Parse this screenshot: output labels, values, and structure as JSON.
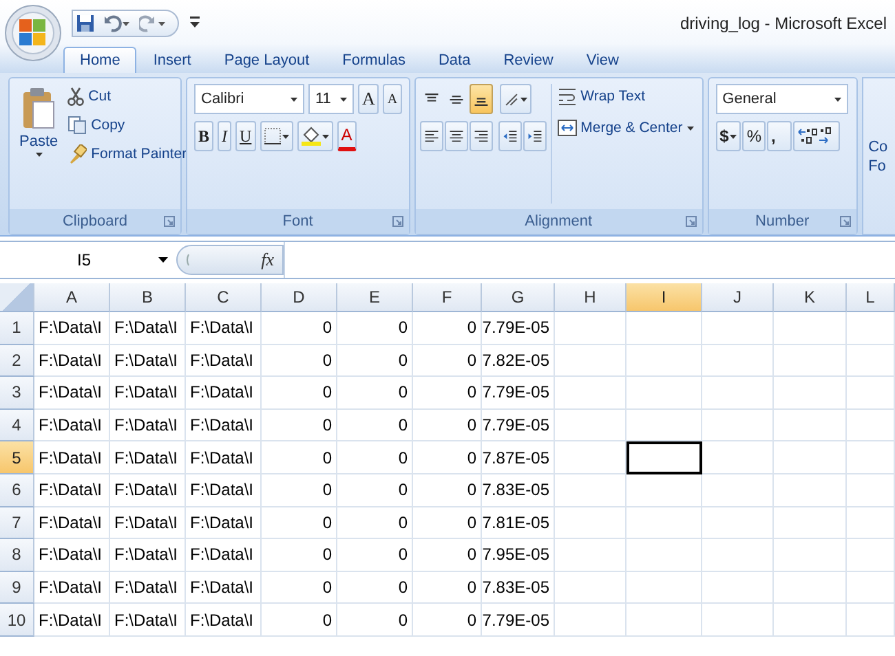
{
  "window": {
    "title": "driving_log - Microsoft Excel"
  },
  "tabs": [
    {
      "label": "Home",
      "selected": true
    },
    {
      "label": "Insert",
      "selected": false
    },
    {
      "label": "Page Layout",
      "selected": false
    },
    {
      "label": "Formulas",
      "selected": false
    },
    {
      "label": "Data",
      "selected": false
    },
    {
      "label": "Review",
      "selected": false
    },
    {
      "label": "View",
      "selected": false
    }
  ],
  "ribbon": {
    "clipboard": {
      "name": "Clipboard",
      "paste": "Paste",
      "cut": "Cut",
      "copy": "Copy",
      "format_painter": "Format Painter"
    },
    "font": {
      "name": "Font",
      "font_name": "Calibri",
      "font_size": "11",
      "grow": "A",
      "shrink": "A",
      "bold": "B",
      "italic": "I",
      "underline": "U",
      "font_color": "A"
    },
    "alignment": {
      "name": "Alignment",
      "vertical": [
        {
          "selected": false
        },
        {
          "selected": false
        },
        {
          "selected": true
        }
      ],
      "wrap_text": "Wrap Text",
      "merge": "Merge & Center"
    },
    "number": {
      "name": "Number",
      "format": "General",
      "currency": "$",
      "percent": "%",
      "comma": ","
    },
    "styles": {
      "line_1": "Co",
      "line_2": "Fo"
    }
  },
  "formula_bar": {
    "name_box": "I5",
    "function_label": "fx"
  },
  "sheet": {
    "columns": [
      {
        "label": "A",
        "selected": false
      },
      {
        "label": "B",
        "selected": false
      },
      {
        "label": "C",
        "selected": false
      },
      {
        "label": "D",
        "selected": false
      },
      {
        "label": "E",
        "selected": false
      },
      {
        "label": "F",
        "selected": false
      },
      {
        "label": "G",
        "selected": false
      },
      {
        "label": "H",
        "selected": false
      },
      {
        "label": "I",
        "selected": true
      },
      {
        "label": "J",
        "selected": false
      },
      {
        "label": "K",
        "selected": false
      },
      {
        "label": "L",
        "selected": false
      }
    ],
    "rows": [
      {
        "number": "1",
        "selected": false,
        "cells": [
          "F:\\Data\\I",
          "F:\\Data\\I",
          "F:\\Data\\I",
          "0",
          "0",
          "0",
          "7.79E-05"
        ]
      },
      {
        "number": "2",
        "selected": false,
        "cells": [
          "F:\\Data\\I",
          "F:\\Data\\I",
          "F:\\Data\\I",
          "0",
          "0",
          "0",
          "7.82E-05"
        ]
      },
      {
        "number": "3",
        "selected": false,
        "cells": [
          "F:\\Data\\I",
          "F:\\Data\\I",
          "F:\\Data\\I",
          "0",
          "0",
          "0",
          "7.79E-05"
        ]
      },
      {
        "number": "4",
        "selected": false,
        "cells": [
          "F:\\Data\\I",
          "F:\\Data\\I",
          "F:\\Data\\I",
          "0",
          "0",
          "0",
          "7.79E-05"
        ]
      },
      {
        "number": "5",
        "selected": true,
        "cells": [
          "F:\\Data\\I",
          "F:\\Data\\I",
          "F:\\Data\\I",
          "0",
          "0",
          "0",
          "7.87E-05"
        ]
      },
      {
        "number": "6",
        "selected": false,
        "cells": [
          "F:\\Data\\I",
          "F:\\Data\\I",
          "F:\\Data\\I",
          "0",
          "0",
          "0",
          "7.83E-05"
        ]
      },
      {
        "number": "7",
        "selected": false,
        "cells": [
          "F:\\Data\\I",
          "F:\\Data\\I",
          "F:\\Data\\I",
          "0",
          "0",
          "0",
          "7.81E-05"
        ]
      },
      {
        "number": "8",
        "selected": false,
        "cells": [
          "F:\\Data\\I",
          "F:\\Data\\I",
          "F:\\Data\\I",
          "0",
          "0",
          "0",
          "7.95E-05"
        ]
      },
      {
        "number": "9",
        "selected": false,
        "cells": [
          "F:\\Data\\I",
          "F:\\Data\\I",
          "F:\\Data\\I",
          "0",
          "0",
          "0",
          "7.83E-05"
        ]
      },
      {
        "number": "10",
        "selected": false,
        "cells": [
          "F:\\Data\\I",
          "F:\\Data\\I",
          "F:\\Data\\I",
          "0",
          "0",
          "0",
          "7.79E-05"
        ]
      }
    ]
  }
}
